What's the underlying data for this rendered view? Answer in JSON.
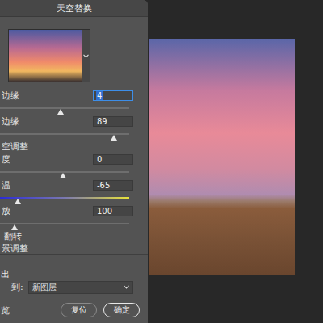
{
  "window": {
    "title": "天空替换"
  },
  "rows": [
    {
      "kind": "slider",
      "label": "边缘",
      "value": "4",
      "level": 0.47,
      "focused": true
    },
    {
      "kind": "slider",
      "label": "边缘",
      "value": "89",
      "level": 0.88,
      "focused": false
    },
    {
      "kind": "header",
      "label": "空调整"
    },
    {
      "kind": "slider",
      "label": "度",
      "value": "0",
      "level": 0.49,
      "focused": false
    },
    {
      "kind": "gradient",
      "label": "温",
      "value": "-65",
      "level": 0.14,
      "focused": false
    },
    {
      "kind": "slider",
      "label": "放",
      "value": "100",
      "level": 0.11,
      "focused": false
    },
    {
      "kind": "option",
      "label": "翻转"
    },
    {
      "kind": "header",
      "label": "景调整"
    }
  ],
  "output": {
    "label": "出",
    "to_label": "到:",
    "value": "新图层"
  },
  "footer": {
    "preview_label": "览",
    "buttons": [
      {
        "label": "复位",
        "primary": false
      },
      {
        "label": "确定",
        "primary": true
      }
    ]
  }
}
